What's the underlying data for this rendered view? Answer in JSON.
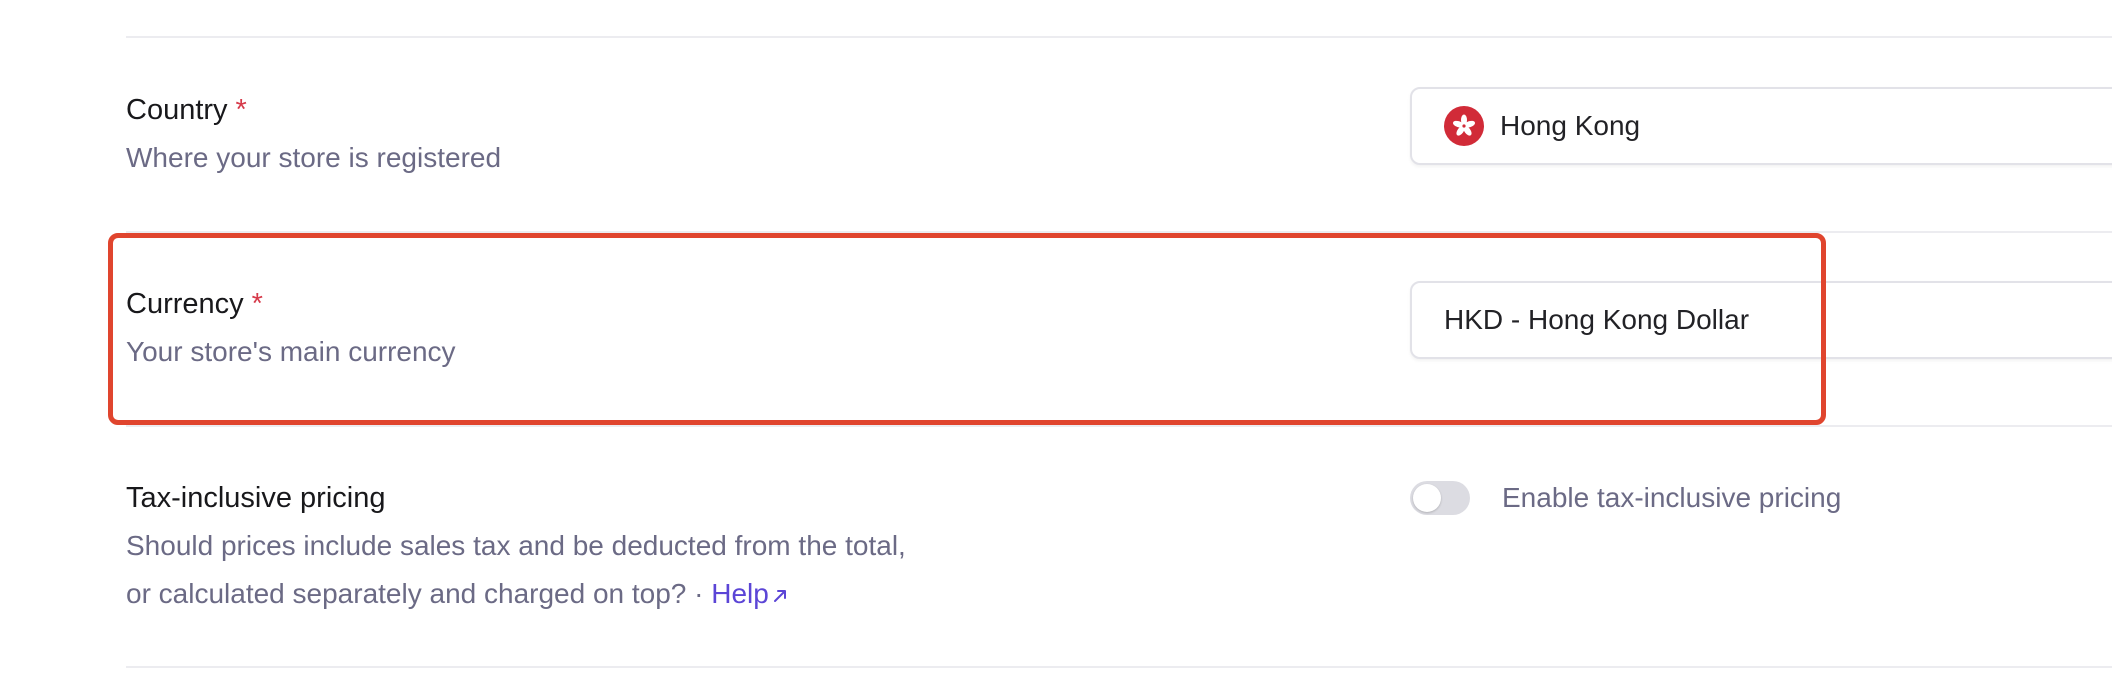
{
  "country": {
    "label": "Country",
    "required_mark": "*",
    "description": "Where your store is registered",
    "value": "Hong Kong",
    "flag_icon": "hong-kong-flag-icon",
    "flag_color": "#d12b38"
  },
  "currency": {
    "label": "Currency",
    "required_mark": "*",
    "description": "Your store's main currency",
    "value": "HKD - Hong Kong Dollar",
    "highlight_color": "#e0452e"
  },
  "tax": {
    "label": "Tax-inclusive pricing",
    "description_line1": "Should prices include sales tax and be deducted from the total,",
    "description_line2": "or calculated separately and charged on top? · ",
    "help_link": "Help",
    "toggle_label": "Enable tax-inclusive pricing",
    "toggle_on": false,
    "link_color": "#5b45d6"
  }
}
